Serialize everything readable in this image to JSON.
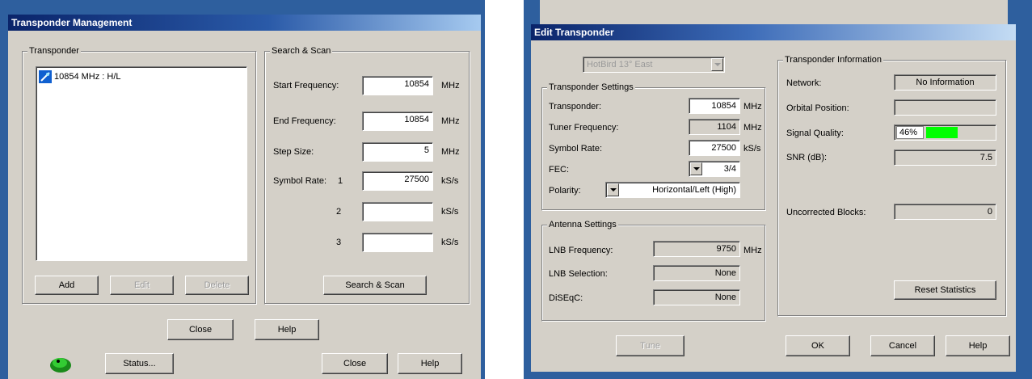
{
  "left_dialog": {
    "title": "Transponder Management",
    "transponder_group": "Transponder",
    "list_items": [
      {
        "label": "10854 MHz  :  H/L",
        "icon": "transponder-icon"
      }
    ],
    "buttons": {
      "add": "Add",
      "edit": "Edit",
      "delete": "Delete"
    },
    "scan_group": "Search & Scan",
    "start_frequency": {
      "label": "Start Frequency:",
      "value": "10854",
      "unit": "MHz"
    },
    "end_frequency": {
      "label": "End Frequency:",
      "value": "10854",
      "unit": "MHz"
    },
    "step_size": {
      "label": "Step Size:",
      "value": "5",
      "unit": "MHz"
    },
    "symbol_rate": {
      "label": "Symbol Rate:",
      "unit": "kS/s",
      "rows": [
        {
          "index": "1",
          "value": "27500"
        },
        {
          "index": "2",
          "value": ""
        },
        {
          "index": "3",
          "value": ""
        }
      ]
    },
    "scan_button": "Search & Scan",
    "close_button": "Close",
    "help_button": "Help"
  },
  "left_background": {
    "status_button": "Status...",
    "close_button": "Close",
    "help_button": "Help"
  },
  "right_dialog": {
    "title": "Edit Transponder",
    "satellite": "HotBird 13° East",
    "transponder_settings": {
      "title": "Transponder Settings",
      "transponder": {
        "label": "Transponder:",
        "value": "10854",
        "unit": "MHz"
      },
      "tuner_frequency": {
        "label": "Tuner Frequency:",
        "value": "1104",
        "unit": "MHz"
      },
      "symbol_rate": {
        "label": "Symbol Rate:",
        "value": "27500",
        "unit": "kS/s"
      },
      "fec": {
        "label": "FEC:",
        "value": "3/4"
      },
      "polarity": {
        "label": "Polarity:",
        "value": "Horizontal/Left (High)"
      }
    },
    "antenna_settings": {
      "title": "Antenna Settings",
      "lnb_frequency": {
        "label": "LNB Frequency:",
        "value": "9750",
        "unit": "MHz"
      },
      "lnb_selection": {
        "label": "LNB Selection:",
        "value": "None"
      },
      "diseqc": {
        "label": "DiSEqC:",
        "value": "None"
      }
    },
    "transponder_info": {
      "title": "Transponder Information",
      "network": {
        "label": "Network:",
        "value": "No Information"
      },
      "orbital_position": {
        "label": "Orbital Position:",
        "value": ""
      },
      "signal_quality": {
        "label": "Signal Quality:",
        "value": "46%",
        "level": 0.46,
        "bar_color": "#00ff00"
      },
      "snr": {
        "label": "SNR (dB):",
        "value": "7.5"
      },
      "uncorrected_blocks": {
        "label": "Uncorrected Blocks:",
        "value": "0"
      },
      "reset_button": "Reset Statistics"
    },
    "tune_button": "Tune",
    "ok_button": "OK",
    "cancel_button": "Cancel",
    "help_button": "Help"
  }
}
